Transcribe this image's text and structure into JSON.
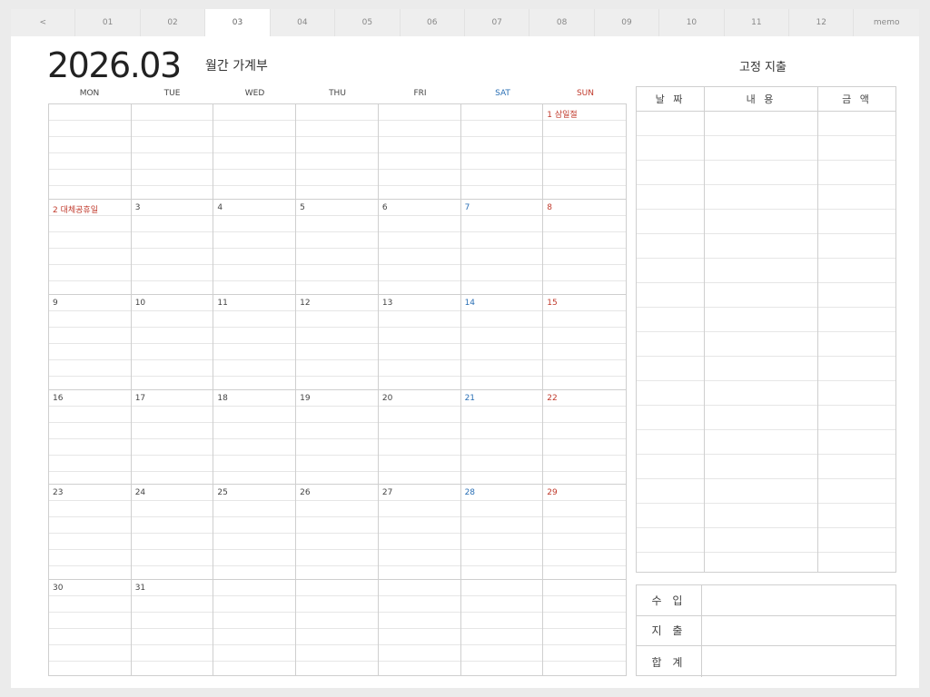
{
  "tabs": [
    {
      "label": "<"
    },
    {
      "label": "01"
    },
    {
      "label": "02"
    },
    {
      "label": "03",
      "active": true
    },
    {
      "label": "04"
    },
    {
      "label": "05"
    },
    {
      "label": "06"
    },
    {
      "label": "07"
    },
    {
      "label": "08"
    },
    {
      "label": "09"
    },
    {
      "label": "10"
    },
    {
      "label": "11"
    },
    {
      "label": "12"
    },
    {
      "label": "memo"
    }
  ],
  "header": {
    "title": "2026.03",
    "subtitle": "월간 가계부",
    "fixed_title": "고정 지출"
  },
  "calendar": {
    "weekdays": [
      "MON",
      "TUE",
      "WED",
      "THU",
      "FRI",
      "SAT",
      "SUN"
    ],
    "weeks": [
      [
        "",
        "",
        "",
        "",
        "",
        "",
        "1 삼일절"
      ],
      [
        "2 대체공휴일",
        "3",
        "4",
        "5",
        "6",
        "7",
        "8"
      ],
      [
        "9",
        "10",
        "11",
        "12",
        "13",
        "14",
        "15"
      ],
      [
        "16",
        "17",
        "18",
        "19",
        "20",
        "21",
        "22"
      ],
      [
        "23",
        "24",
        "25",
        "26",
        "27",
        "28",
        "29"
      ],
      [
        "30",
        "31",
        "",
        "",
        "",
        "",
        ""
      ]
    ],
    "holidays": [
      "1 삼일절",
      "2 대체공휴일"
    ]
  },
  "fixed_expense": {
    "headers": [
      "날 짜",
      "내 용",
      "금 액"
    ]
  },
  "summary": {
    "rows": [
      "수 입",
      "지 출",
      "합 계"
    ]
  },
  "colors": {
    "saturday": "#2a6fb5",
    "sunday": "#c0392b",
    "grid": "#cfcfcf"
  }
}
